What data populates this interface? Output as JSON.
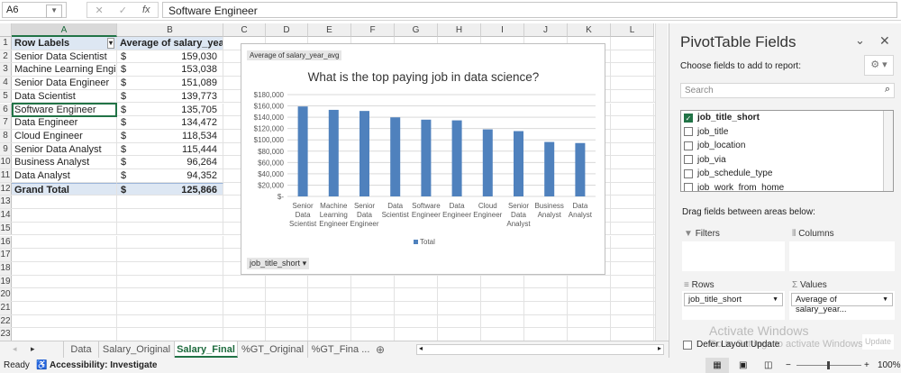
{
  "formula_bar": {
    "name_box": "A6",
    "fx": "fx",
    "cancel": "✕",
    "enter": "✓",
    "content": "Software Engineer"
  },
  "columns": [
    "A",
    "B",
    "C",
    "D",
    "E",
    "F",
    "G",
    "H",
    "I",
    "J",
    "K",
    "L"
  ],
  "pivot": {
    "header": {
      "label": "Row Labels",
      "value": "Average of salary_year_avg"
    },
    "rows": [
      {
        "label": "Senior Data Scientist",
        "value": "159,030"
      },
      {
        "label": "Machine Learning Engineer",
        "value": "153,038"
      },
      {
        "label": "Senior Data Engineer",
        "value": "151,089"
      },
      {
        "label": "Data Scientist",
        "value": "139,773"
      },
      {
        "label": "Software Engineer",
        "value": "135,705"
      },
      {
        "label": "Data Engineer",
        "value": "134,472"
      },
      {
        "label": "Cloud Engineer",
        "value": "118,534"
      },
      {
        "label": "Senior Data Analyst",
        "value": "115,444"
      },
      {
        "label": "Business Analyst",
        "value": "96,264"
      },
      {
        "label": "Data Analyst",
        "value": "94,352"
      }
    ],
    "total": {
      "label": "Grand Total",
      "value": "125,866"
    },
    "currency": "$"
  },
  "chart_data": {
    "type": "bar",
    "title": "What is the top paying job in data science?",
    "value_field_button": "Average of salary_year_avg",
    "axis_field_button": "job_title_short",
    "categories": [
      [
        "Senior",
        "Data",
        "Scientist"
      ],
      [
        "Machine",
        "Learning",
        "Engineer"
      ],
      [
        "Senior",
        "Data",
        "Engineer"
      ],
      [
        "Data",
        "Scientist"
      ],
      [
        "Software",
        "Engineer"
      ],
      [
        "Data",
        "Engineer"
      ],
      [
        "Cloud",
        "Engineer"
      ],
      [
        "Senior",
        "Data",
        "Analyst"
      ],
      [
        "Business",
        "Analyst"
      ],
      [
        "Data",
        "Analyst"
      ]
    ],
    "values": [
      159030,
      153038,
      151089,
      139773,
      135705,
      134472,
      118534,
      115444,
      96264,
      94352
    ],
    "ylim": [
      0,
      180000
    ],
    "yticks": [
      "$-",
      "$20,000",
      "$40,000",
      "$60,000",
      "$80,000",
      "$100,000",
      "$120,000",
      "$140,000",
      "$160,000",
      "$180,000"
    ],
    "legend": "Total",
    "color": "#4f81bd"
  },
  "sheet_tabs": [
    "Data",
    "Salary_Original",
    "Salary_Final",
    "%GT_Original",
    "%GT_Fina ..."
  ],
  "status": {
    "ready": "Ready",
    "accessibility": "Accessibility: Investigate",
    "zoom": "100%"
  },
  "pane": {
    "title": "PivotTable Fields",
    "choose": "Choose fields to add to report:",
    "search_placeholder": "Search",
    "fields": [
      {
        "name": "job_title_short",
        "checked": true
      },
      {
        "name": "job_title"
      },
      {
        "name": "job_location"
      },
      {
        "name": "job_via"
      },
      {
        "name": "job_schedule_type"
      },
      {
        "name": "job_work_from_home"
      }
    ],
    "drag_text": "Drag fields between areas below:",
    "filters": "Filters",
    "columns": "Columns",
    "rows": "Rows",
    "values": "Values",
    "rows_item": "job_title_short",
    "values_item": "Average of salary_year...",
    "defer": "Defer Layout Update",
    "update": "Update",
    "watermark1": "Activate Windows",
    "watermark2": "Go to Settings to activate Windows."
  }
}
